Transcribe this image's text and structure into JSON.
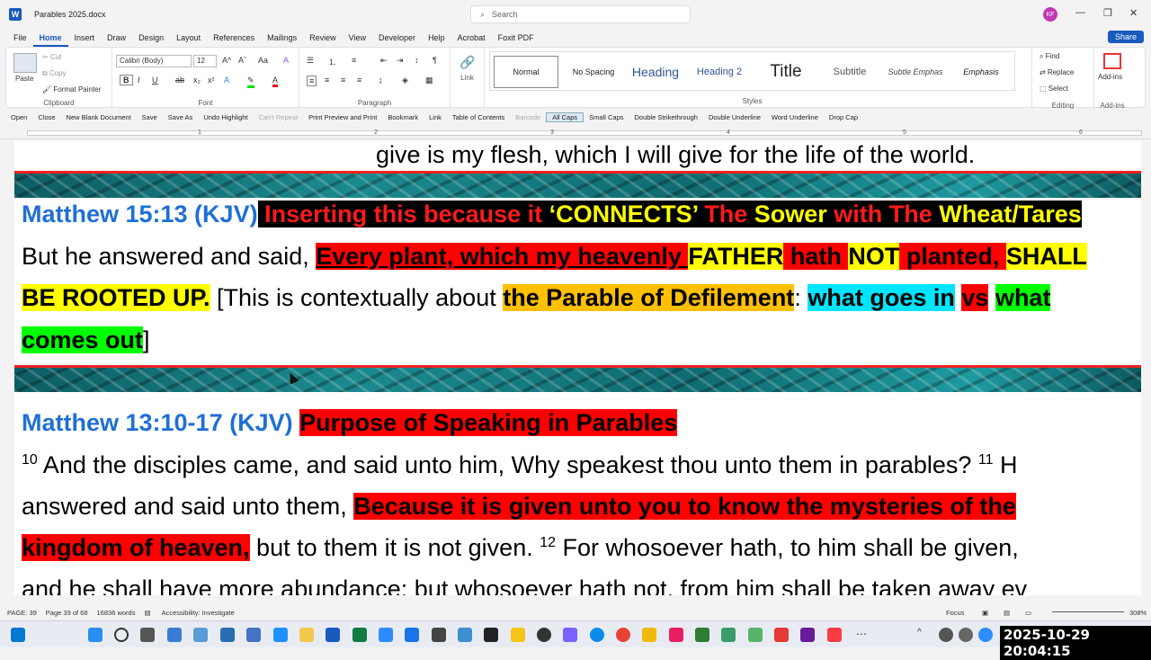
{
  "window": {
    "doc_title": "Parables 2025.docx",
    "search_placeholder": "Search",
    "avatar_initials": "KF"
  },
  "tabs": [
    "File",
    "Home",
    "Insert",
    "Draw",
    "Design",
    "Layout",
    "References",
    "Mailings",
    "Review",
    "View",
    "Developer",
    "Help",
    "Acrobat",
    "Foxit PDF"
  ],
  "active_tab": "Home",
  "share_label": "Share",
  "ribbon": {
    "clipboard": {
      "paste": "Paste",
      "cut": "Cut",
      "copy": "Copy",
      "format_painter": "Format Painter",
      "label": "Clipboard"
    },
    "font": {
      "name": "Calibri (Body)",
      "size": "12",
      "label": "Font"
    },
    "paragraph": {
      "label": "Paragraph"
    },
    "link": {
      "label": "Link"
    },
    "styles": {
      "items": [
        "Normal",
        "No Spacing",
        "Heading",
        "Heading 2",
        "Title",
        "Subtitle",
        "Subtle Emphas",
        "Emphasis"
      ],
      "label": "Styles"
    },
    "editing": {
      "find": "Find",
      "replace": "Replace",
      "select": "Select",
      "label": "Editing"
    },
    "addins": {
      "label": "Add-ins",
      "button": "Add-ins"
    }
  },
  "qat": [
    "Open",
    "Close",
    "New Blank Document",
    "Save",
    "Save As",
    "Undo Highlight",
    "Can't Repeat",
    "Print Preview and Print",
    "Bookmark",
    "Link",
    "Table of Contents",
    "Barcode",
    "All Caps",
    "Small Caps",
    "Double Strikethrough",
    "Double Underline",
    "Word Underline",
    "Drop Cap"
  ],
  "ruler_numbers": [
    "1",
    "2",
    "3",
    "4",
    "5",
    "6"
  ],
  "doc": {
    "line0": "give is my flesh, which I will give for the life of the world.",
    "m1_ref": "Matthew 15:13 (KJV)",
    "m1_h1": " Inserting this because it ",
    "m1_h2": "‘CONNECTS’",
    "m1_h3": " The ",
    "m1_h4": "Sower",
    "m1_h5": " with The ",
    "m1_h6": "Wheat/Tares",
    "m1_l1a": " But he answered and said, ",
    "m1_l1b": "Every plant, which my heavenly ",
    "m1_l1c": "FATHER",
    "m1_l1d": " hath ",
    "m1_l1e": "NOT",
    "m1_l1f": " planted, ",
    "m1_l1g": "SHALL",
    "m1_l2a": "BE ROOTED UP.",
    "m1_l2b": " [This is contextually about ",
    "m1_l2c": "the Parable of Defilement",
    "m1_l2d": ": ",
    "m1_l2e": "what goes in",
    "m1_l2f": " ",
    "m1_l2g": "vs",
    "m1_l2h": " ",
    "m1_l2i": "what",
    "m1_l3a": "comes out",
    "m1_l3b": "]",
    "m2_ref": "Matthew 13:10-17 (KJV)",
    "m2_title": "Purpose of Speaking in Parables",
    "m2_v10": "10",
    "m2_l1": " And the disciples came, and said unto him, Why speakest thou unto them in parables? ",
    "m2_v11": "11",
    "m2_l1b": " H",
    "m2_l2a": "answered and said unto them, ",
    "m2_l2b": "Because it is given unto you to know the mysteries of the",
    "m2_l3a": "kingdom of heaven,",
    "m2_l3b": " but to them it is not given. ",
    "m2_v12": "12",
    "m2_l3c": " For whosoever hath, to him shall be given,",
    "m2_l4": "and he shall have more abundance: but whosoever hath not, from him shall be taken away ev"
  },
  "status": {
    "page": "PAGE: 39",
    "page_of": "Page 39 of 68",
    "words": "16836 words",
    "accessibility": "Accessibility: Investigate",
    "focus": "Focus",
    "zoom": "308%"
  },
  "clock": "2025-10-29  20:04:15"
}
